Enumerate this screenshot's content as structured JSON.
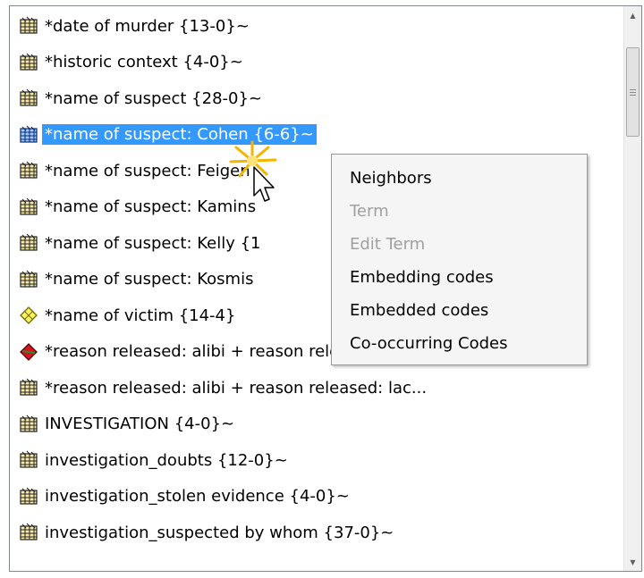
{
  "codes_list": {
    "items": [
      {
        "label": "*date of murder {13-0}~",
        "icon": "code-icon-hatched",
        "selected": false
      },
      {
        "label": "*historic context {4-0}~",
        "icon": "code-icon-hatched",
        "selected": false
      },
      {
        "label": "*name of suspect {28-0}~",
        "icon": "code-icon-hatched",
        "selected": false
      },
      {
        "label": "*name of suspect: Cohen {6-6}~",
        "icon": "code-icon-hatched-blue",
        "selected": true
      },
      {
        "label": "*name of suspect: Feigen",
        "icon": "code-icon-hatched",
        "selected": false
      },
      {
        "label": "*name of suspect: Kamins",
        "icon": "code-icon-hatched",
        "selected": false
      },
      {
        "label": "*name of suspect: Kelly {1",
        "icon": "code-icon-hatched",
        "selected": false
      },
      {
        "label": "*name of suspect: Kosmis",
        "icon": "code-icon-hatched",
        "selected": false
      },
      {
        "label": "*name of victim {14-4}",
        "icon": "code-icon-yellow",
        "selected": false
      },
      {
        "label": "*reason released: alibi + reason released: lac...",
        "icon": "code-icon-red",
        "selected": false
      },
      {
        "label": "*reason released: alibi + reason released: lac...",
        "icon": "code-icon-hatched",
        "selected": false
      },
      {
        "label": "INVESTIGATION {4-0}~",
        "icon": "code-icon-hatched",
        "selected": false
      },
      {
        "label": "investigation_doubts {12-0}~",
        "icon": "code-icon-hatched",
        "selected": false
      },
      {
        "label": "investigation_stolen evidence {4-0}~",
        "icon": "code-icon-hatched",
        "selected": false
      },
      {
        "label": "investigation_suspected by whom {37-0}~",
        "icon": "code-icon-hatched",
        "selected": false
      }
    ]
  },
  "context_menu": {
    "items": [
      {
        "label": "Neighbors",
        "enabled": true
      },
      {
        "label": "Term",
        "enabled": false
      },
      {
        "label": "Edit Term",
        "enabled": false
      },
      {
        "label": "Embedding codes",
        "enabled": true
      },
      {
        "label": "Embedded codes",
        "enabled": true
      },
      {
        "label": "Co-occurring Codes",
        "enabled": true
      }
    ]
  },
  "colors": {
    "selection": "#3399ff",
    "menu_bg": "#f5f5f5",
    "disabled_text": "#a0a0a0"
  }
}
